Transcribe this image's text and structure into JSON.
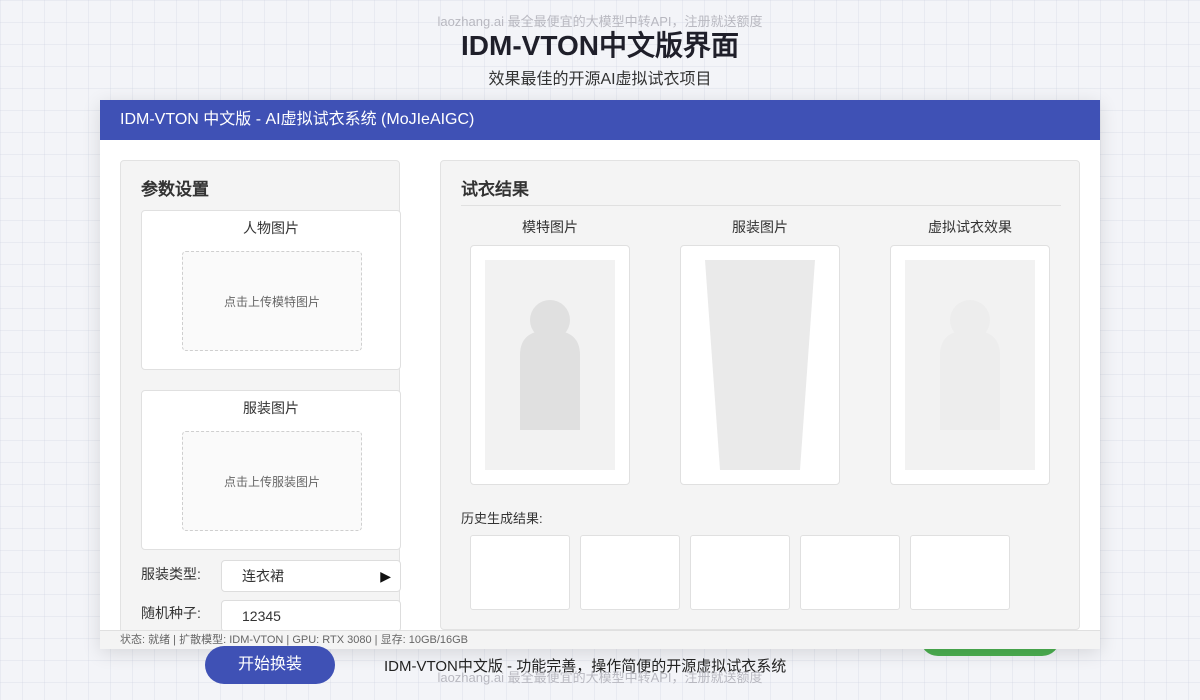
{
  "watermark": "laozhang.ai 最全最便宜的大模型中转API，注册就送额度",
  "page": {
    "title": "IDM-VTON中文版界面",
    "subtitle": "效果最佳的开源AI虚拟试衣项目"
  },
  "window": {
    "title": "IDM-VTON 中文版 - AI虚拟试衣系统 (MoJIeAIGC)"
  },
  "params": {
    "title": "参数设置",
    "person_upload": {
      "label": "人物图片",
      "placeholder": "点击上传模特图片"
    },
    "garment_upload": {
      "label": "服装图片",
      "placeholder": "点击上传服装图片"
    },
    "garment_type": {
      "label": "服装类型:",
      "value": "连衣裙"
    },
    "seed": {
      "label": "随机种子:",
      "value": "12345"
    }
  },
  "results": {
    "title": "试衣结果",
    "columns": [
      "模特图片",
      "服装图片",
      "虚拟试衣效果"
    ],
    "history_label": "历史生成结果:"
  },
  "status": "状态: 就绪 | 扩散模型: IDM-VTON | GPU: RTX 3080 | 显存: 10GB/16GB",
  "start_button": "开始换装",
  "footer": "IDM-VTON中文版 - 功能完善，操作简便的开源虚拟试衣系统",
  "colors": {
    "primary": "#3f51b5",
    "accent_green": "#4caf50",
    "panel_bg": "#f4f4f4",
    "placeholder_gray": "#e2e2e2"
  }
}
